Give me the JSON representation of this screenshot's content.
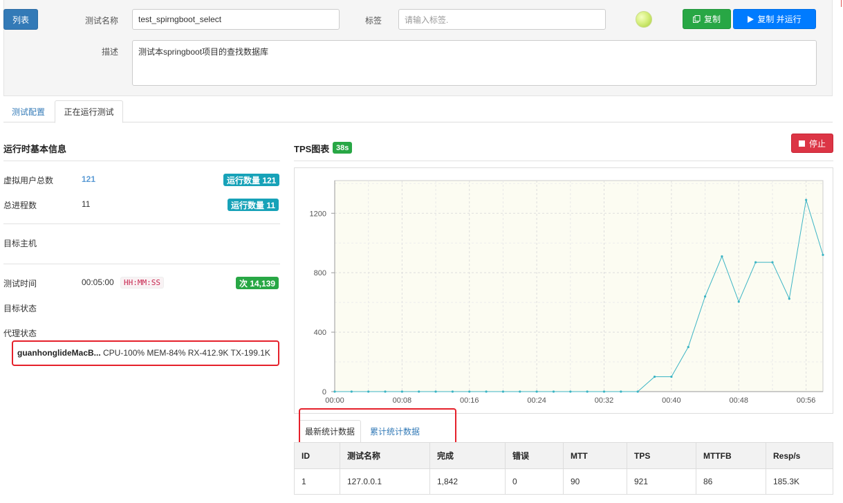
{
  "header": {
    "list_button": "列表",
    "name_label": "测试名称",
    "name_value": "test_spirngboot_select",
    "tag_label": "标签",
    "tag_placeholder": "请输入标签.",
    "desc_label": "描述",
    "desc_value": "测试本springboot项目的查找数据库",
    "copy_button": "复制",
    "copy_run_button": "复制 并运行"
  },
  "tabs": [
    "测试配置",
    "正在运行测试"
  ],
  "runtime": {
    "title": "运行时基本信息",
    "vusers_label": "虚拟用户总数",
    "vusers_value": "121",
    "vusers_badge": "运行数量 121",
    "procs_label": "总进程数",
    "procs_value": "11",
    "procs_badge": "运行数量 11",
    "target_host_label": "目标主机",
    "test_time_label": "测试时间",
    "test_time_value": "00:05:00",
    "test_time_format": "HH:MM:SS",
    "count_badge": "次 14,139",
    "target_status_label": "目标状态",
    "agent_status_label": "代理状态",
    "agent_name": "guanhonglideMacB...",
    "agent_stats": "CPU-100% MEM-84% RX-412.9K TX-199.1K"
  },
  "tps": {
    "title": "TPS图表",
    "elapsed_badge": "38s",
    "stop_button": "停止"
  },
  "chart_data": {
    "type": "line",
    "title": "",
    "x": [
      "00:00",
      "00:02",
      "00:04",
      "00:06",
      "00:08",
      "00:10",
      "00:12",
      "00:14",
      "00:16",
      "00:18",
      "00:20",
      "00:22",
      "00:24",
      "00:26",
      "00:28",
      "00:30",
      "00:32",
      "00:34",
      "00:36",
      "00:38",
      "00:40",
      "00:42",
      "00:44",
      "00:46",
      "00:48",
      "00:50",
      "00:52",
      "00:54",
      "00:56",
      "00:58"
    ],
    "y": [
      0,
      0,
      0,
      0,
      0,
      0,
      0,
      0,
      0,
      0,
      0,
      0,
      0,
      0,
      0,
      0,
      0,
      0,
      0,
      100,
      100,
      300,
      640,
      910,
      605,
      870,
      870,
      625,
      1290,
      920
    ],
    "x_tick_labels": [
      "00:00",
      "00:08",
      "00:16",
      "00:24",
      "00:32",
      "00:40",
      "00:48",
      "00:56"
    ],
    "y_tick_labels": [
      "0",
      "400",
      "800",
      "1200"
    ],
    "ylim": [
      0,
      1420
    ],
    "grid": true,
    "line_color": "#3bb4c4"
  },
  "stats_tabs": [
    "最新统计数据",
    "累计统计数据"
  ],
  "table": {
    "headers": [
      "ID",
      "测试名称",
      "完成",
      "错误",
      "MTT",
      "TPS",
      "MTTFB",
      "Resp/s"
    ],
    "rows": [
      [
        "1",
        "127.0.0.1",
        "1,842",
        "0",
        "90",
        "921",
        "86",
        "185.3K"
      ]
    ]
  }
}
